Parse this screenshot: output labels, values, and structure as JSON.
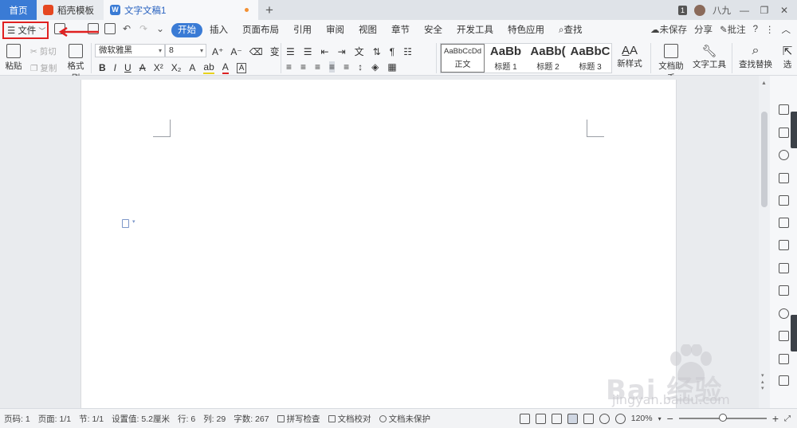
{
  "tabs": [
    {
      "label": "首页",
      "active": false
    },
    {
      "label": "稻壳模板",
      "active": false
    },
    {
      "label": "文字文稿1",
      "active": true,
      "modified": true
    }
  ],
  "titlebar_right": {
    "badge": "1",
    "user": "八九"
  },
  "file_menu": {
    "label": "文件",
    "highlighted": true,
    "highlight_color": "#e02020"
  },
  "menus": [
    "开始",
    "插入",
    "页面布局",
    "引用",
    "审阅",
    "视图",
    "章节",
    "安全",
    "开发工具",
    "特色应用",
    "查找"
  ],
  "active_menu": "开始",
  "menu_right": {
    "unsaved": "未保存",
    "share": "分享",
    "comment": "批注"
  },
  "ribbon": {
    "paste": "粘贴",
    "cut": "剪切",
    "copy": "复制",
    "format_painter": "格式刷",
    "font_name": "微软雅黑",
    "font_size": "8",
    "styles": [
      {
        "preview": "AaBbCcDd",
        "label": "正文"
      },
      {
        "preview": "AaBb",
        "label": "标题 1"
      },
      {
        "preview": "AaBb(",
        "label": "标题 2"
      },
      {
        "preview": "AaBbC",
        "label": "标题 3"
      }
    ],
    "new_style": "新样式",
    "doc_assistant": "文档助手",
    "text_tools": "文字工具",
    "find_replace": "查找替换",
    "select": "选"
  },
  "status": {
    "page_num": "页码: 1",
    "pages": "页面: 1/1",
    "section": "节: 1/1",
    "setting": "设置值: 5.2厘米",
    "row": "行: 6",
    "col": "列: 29",
    "word_count": "字数: 267",
    "spell_check": "拼写检查",
    "proofread": "文档校对",
    "protection": "文档未保护",
    "zoom": "120%"
  },
  "watermark": {
    "text": "Bai 经验",
    "url": "jingyan.baidu.com"
  },
  "colors": {
    "accent": "#3a7bd5",
    "modified_dot": "#f39033",
    "annotation_red": "#e02020"
  }
}
